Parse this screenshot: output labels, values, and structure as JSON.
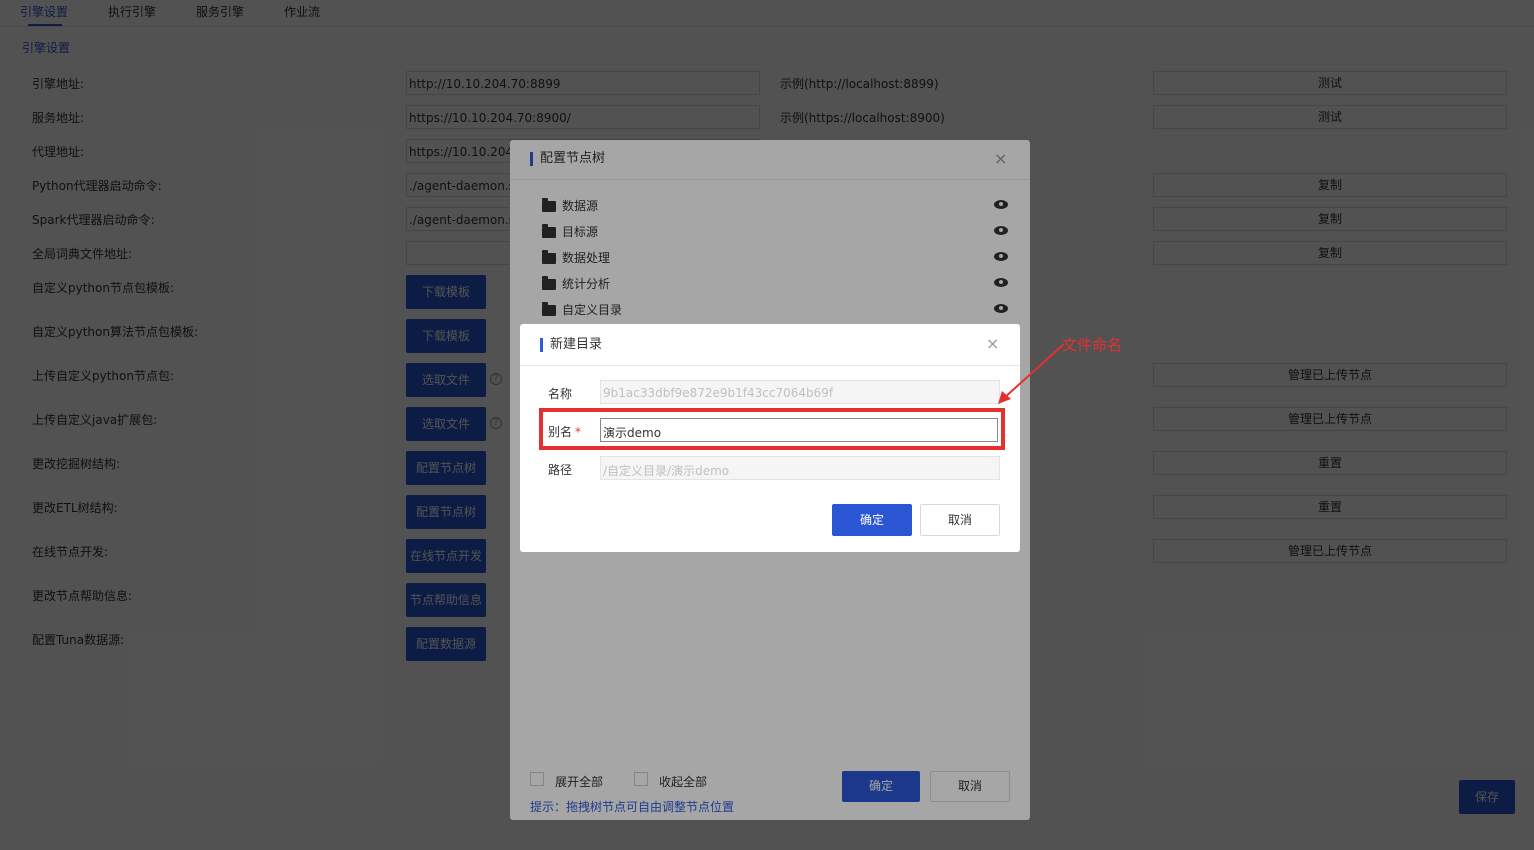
{
  "tabs": [
    {
      "label": "引擎设置"
    },
    {
      "label": "执行引擎"
    },
    {
      "label": "服务引擎"
    },
    {
      "label": "作业流"
    }
  ],
  "settings": {
    "section_title": "引擎设置",
    "engine_addr": {
      "label": "引擎地址:",
      "value": "http://10.10.204.70:8899",
      "example": "示例(http://localhost:8899)",
      "button": "测试"
    },
    "service_addr": {
      "label": "服务地址:",
      "value": "https://10.10.204.70:8900/",
      "example": "示例(https://localhost:8900)",
      "button": "测试"
    },
    "proxy_addr": {
      "label": "代理地址:",
      "value": "https://10.10.204.7"
    },
    "python_proxy": {
      "label": "Python代理器启动命令:",
      "value": "./agent-daemon.sl",
      "button": "复制"
    },
    "spark_proxy": {
      "label": "Spark代理器启动命令:",
      "value": "./agent-daemon.sl",
      "button": "复制"
    },
    "dict_addr": {
      "label": "全局词典文件地址:",
      "value": "",
      "button": "复制"
    },
    "py_node_tpl": {
      "label": "自定义python节点包模板:",
      "button": "下载模板"
    },
    "py_algo_tpl": {
      "label": "自定义python算法节点包模板:",
      "button": "下载模板"
    },
    "upload_py": {
      "label": "上传自定义python节点包:",
      "button": "选取文件",
      "right_button": "管理已上传节点"
    },
    "upload_java": {
      "label": "上传自定义java扩展包:",
      "button": "选取文件",
      "right_button": "管理已上传节点"
    },
    "mining_tree": {
      "label": "更改挖掘树结构:",
      "button": "配置节点树",
      "right_button": "重置"
    },
    "etl_tree": {
      "label": "更改ETL树结构:",
      "button": "配置节点树",
      "right_button": "重置"
    },
    "online_dev": {
      "label": "在线节点开发:",
      "button": "在线节点开发",
      "right_button": "管理已上传节点"
    },
    "help_info": {
      "label": "更改节点帮助信息:",
      "button": "节点帮助信息"
    },
    "tuna": {
      "label": "配置Tuna数据源:",
      "button": "配置数据源"
    },
    "help_glyph": "?",
    "save": "保存"
  },
  "tree_dialog": {
    "title": "配置节点树",
    "close": "×",
    "items": [
      {
        "label": "数据源"
      },
      {
        "label": "目标源"
      },
      {
        "label": "数据处理"
      },
      {
        "label": "统计分析"
      },
      {
        "label": "自定义目录"
      }
    ],
    "expand_all": "展开全部",
    "collapse_all": "收起全部",
    "hint": "提示：拖拽树节点可自由调整节点位置",
    "ok": "确定",
    "cancel": "取消"
  },
  "new_dir_dialog": {
    "title": "新建目录",
    "close": "×",
    "name_label": "名称",
    "name_value": "9b1ac33dbf9e872e9b1f43cc7064b69f",
    "alias_label": "别名",
    "alias_required": "*",
    "alias_value": "演示demo",
    "path_label": "路径",
    "path_value": "/自定义目录/演示demo",
    "ok": "确定",
    "cancel": "取消"
  },
  "annotation": {
    "text": "文件命名",
    "color": "#e53030"
  },
  "colors": {
    "primary": "#2a56d4",
    "accent": "#2f5bd8",
    "highlight": "#e53030"
  }
}
